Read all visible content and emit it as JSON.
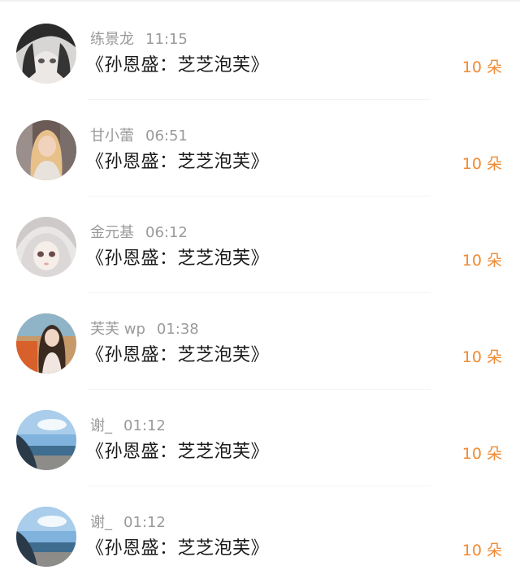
{
  "items": [
    {
      "name": "练景龙",
      "time": "11:15",
      "title": "《孙恩盛：芝芝泡芙》",
      "gift": "10 朵",
      "avatar": "avatar-anime-dark-hair"
    },
    {
      "name": "甘小蕾",
      "time": "06:51",
      "title": "《孙恩盛：芝芝泡芙》",
      "gift": "10 朵",
      "avatar": "avatar-photo-blonde"
    },
    {
      "name": "金元基",
      "time": "06:12",
      "title": "《孙恩盛：芝芝泡芙》",
      "gift": "10 朵",
      "avatar": "avatar-anime-white-hair"
    },
    {
      "name": "芙芙 wp",
      "time": "01:38",
      "title": "《孙恩盛：芝芝泡芙》",
      "gift": "10 朵",
      "avatar": "avatar-photo-car"
    },
    {
      "name": "谢_",
      "time": "01:12",
      "title": "《孙恩盛：芝芝泡芙》",
      "gift": "10 朵",
      "avatar": "avatar-photo-beach"
    },
    {
      "name": "谢_",
      "time": "01:12",
      "title": "《孙恩盛：芝芝泡芙》",
      "gift": "10 朵",
      "avatar": "avatar-photo-beach"
    }
  ],
  "colors": {
    "gift": "#f08a34",
    "meta": "#9a9a9a",
    "title": "#1a1a1a"
  }
}
